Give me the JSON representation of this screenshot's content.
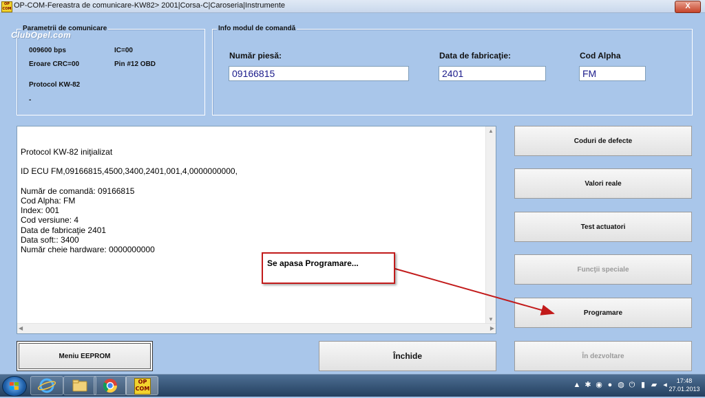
{
  "window": {
    "title": "OP-COM-Fereastra de comunicare-KW82> 2001|Corsa-C|Caroseria|Instrumente",
    "app_icon_text": "OP COM",
    "close_label": "X"
  },
  "comm_params": {
    "title": "Parametrii de comunicare",
    "watermark": "ClubOpel.com",
    "baud": "009600 bps",
    "ic": "IC=00",
    "crc": "Eroare CRC=00",
    "pin": "Pin #12 OBD",
    "protocol": "Protocol KW-82",
    "dash": "-"
  },
  "module_info": {
    "title": "Info modul de comandă",
    "part_label": "Număr piesă:",
    "part_value": "09166815",
    "date_label": "Data de fabricaţie:",
    "date_value": "2401",
    "alpha_label": "Cod Alpha",
    "alpha_value": "FM"
  },
  "log": {
    "lines": [
      "Protocol KW-82 iniţializat",
      "",
      "ID ECU FM,09166815,4500,3400,2401,001,4,0000000000,",
      "",
      "Număr de comandă: 09166815",
      "Cod Alpha: FM",
      "Index: 001",
      "Cod versiune: 4",
      "Data de fabricaţie 2401",
      "Data soft:: 3400",
      "Număr cheie hardware: 0000000000"
    ]
  },
  "buttons": {
    "fault_codes": "Coduri de defecte",
    "real_values": "Valori reale",
    "actuator_test": "Test actuatori",
    "special_functions": "Funcţii speciale",
    "programming": "Programare",
    "eeprom_menu": "Meniu EEPROM",
    "close": "Închide",
    "in_development": "În dezvoltare"
  },
  "callout": {
    "text": "Se apasa Programare...",
    "color": "#c21a1a"
  },
  "taskbar": {
    "app_label": "OP COM",
    "time": "17:48",
    "date": "27.01.2013"
  }
}
